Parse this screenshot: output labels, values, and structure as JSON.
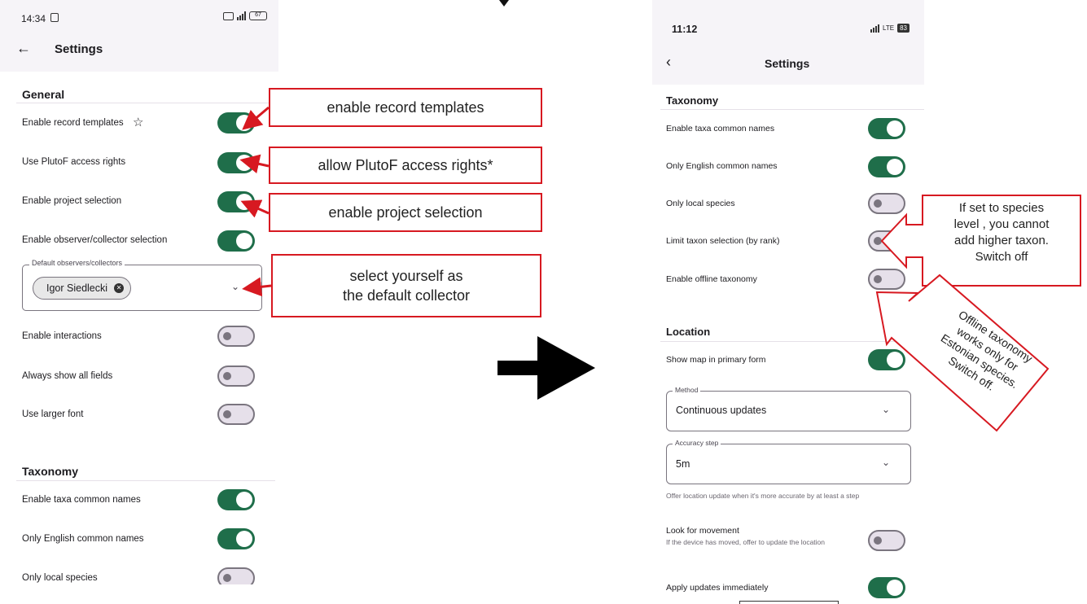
{
  "left_phone": {
    "status": {
      "time": "14:34",
      "battery": "67"
    },
    "title": "Settings",
    "general": {
      "heading": "General",
      "items": [
        {
          "label": "Enable record templates",
          "on": true
        },
        {
          "label": "Use PlutoF access rights",
          "on": true
        },
        {
          "label": "Enable project selection",
          "on": true
        },
        {
          "label": "Enable observer/collector selection",
          "on": true
        }
      ],
      "observers_field": {
        "legend": "Default observers/collectors",
        "chip": "Igor Siedlecki"
      },
      "more_items": [
        {
          "label": "Enable interactions",
          "on": false
        },
        {
          "label": "Always show all fields",
          "on": false
        },
        {
          "label": "Use larger font",
          "on": false
        }
      ]
    },
    "taxonomy": {
      "heading": "Taxonomy",
      "items": [
        {
          "label": "Enable taxa common names",
          "on": true
        },
        {
          "label": "Only English common names",
          "on": true
        },
        {
          "label": "Only local species",
          "on": false
        }
      ]
    }
  },
  "annotations": {
    "templates": "enable record templates",
    "access": "allow PlutoF access rights*",
    "project": "enable project selection",
    "collector_line1": "select yourself as",
    "collector_line2": "the default collector",
    "rank_line1": "If set to species",
    "rank_line2": "level , you cannot",
    "rank_line3": "add higher taxon.",
    "rank_line4": "Switch off",
    "offline_line1": "Offline taxonomy",
    "offline_line2": "works only for",
    "offline_line3": "Estonian species.",
    "offline_line4": "Switch off."
  },
  "right_phone": {
    "status": {
      "time": "11:12",
      "network": "LTE",
      "battery": "83"
    },
    "title": "Settings",
    "taxonomy": {
      "heading": "Taxonomy",
      "items": [
        {
          "label": "Enable taxa common names",
          "on": true
        },
        {
          "label": "Only English common names",
          "on": true
        },
        {
          "label": "Only local species",
          "on": false
        },
        {
          "label": "Limit taxon selection (by rank)",
          "on": false
        },
        {
          "label": "Enable offline taxonomy",
          "on": false
        }
      ]
    },
    "location": {
      "heading": "Location",
      "show_map": {
        "label": "Show map in primary form",
        "on": true
      },
      "method": {
        "legend": "Method",
        "value": "Continuous updates"
      },
      "accuracy": {
        "legend": "Accuracy step",
        "value": "5m"
      },
      "accuracy_hint": "Offer location update when it's more accurate by at least a step",
      "movement": {
        "label": "Look for movement",
        "hint": "If the device has moved, offer to update the location",
        "on": false
      },
      "apply": {
        "label": "Apply updates immediately",
        "on": true
      }
    }
  },
  "colors": {
    "switch_on": "#1f6e4a",
    "annotation_red": "#d71921"
  },
  "icons": [
    "back-arrow-icon",
    "star-icon",
    "chevron-down-icon",
    "remove-chip-icon",
    "right-arrow-icon"
  ]
}
